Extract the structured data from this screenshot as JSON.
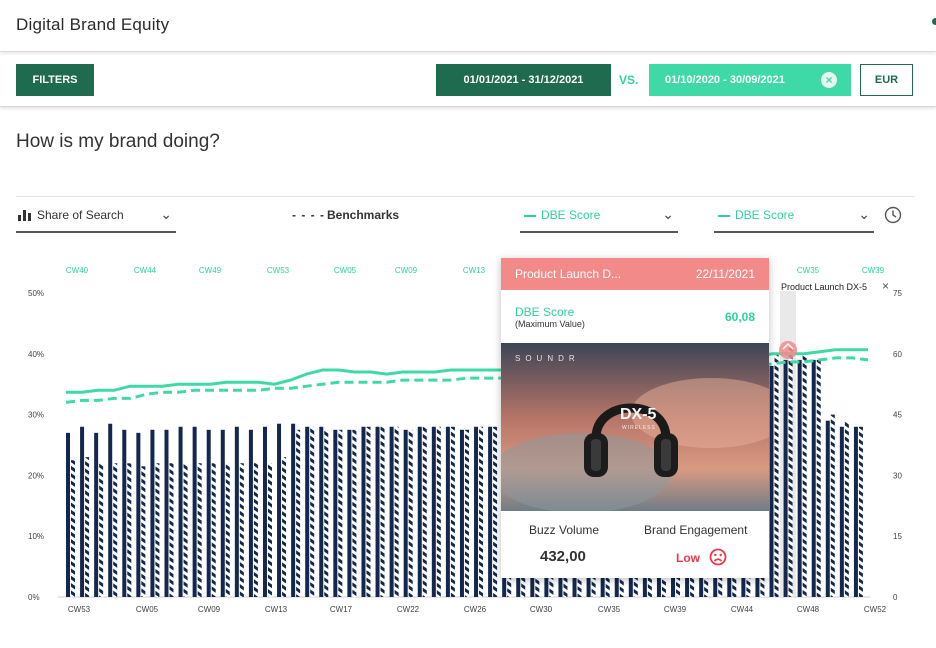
{
  "app": {
    "title": "Digital Brand Equity"
  },
  "filters": {
    "filters_label": "FILTERS",
    "date_range": "01/01/2021 - 31/12/2021",
    "vs_label": "VS.",
    "compare_range": "01/10/2020 - 30/09/2021",
    "currency": "EUR"
  },
  "page": {
    "question": "How is my brand doing?"
  },
  "controls": {
    "share_of_search": "Share of Search",
    "benchmarks": "Benchmarks",
    "dbe_score_1": "DBE Score",
    "dbe_score_2": "DBE Score"
  },
  "colors": {
    "brand_green": "#1f6b50",
    "accent_mint": "#3fd9a7",
    "bar_navy": "#14274e",
    "tooltip_header": "#f28a8a",
    "low_red": "#e83a4a"
  },
  "tooltip": {
    "title": "Product Launch D...",
    "date": "22/11/2021",
    "score_label": "DBE Score",
    "score_sub": "(Maximum Value)",
    "score_value": "60,08",
    "image": {
      "brand": "SOUNDR",
      "model": "DX-5",
      "subtitle": "WIRELESS"
    },
    "buzz_label": "Buzz Volume",
    "buzz_value": "432,00",
    "engagement_label": "Brand Engagement",
    "engagement_value": "Low"
  },
  "event_marker": {
    "label": "Product Launch DX-5"
  },
  "chart_data": {
    "type": "bar",
    "left_axis": {
      "ticks": [
        "0%",
        "10%",
        "20%",
        "30%",
        "40%",
        "50%"
      ],
      "range": [
        0,
        50
      ]
    },
    "right_axis": {
      "ticks": [
        "0",
        "15",
        "30",
        "45",
        "60",
        "75"
      ],
      "range": [
        0,
        75
      ]
    },
    "top_week_labels": [
      "CW40",
      "CW44",
      "CW49",
      "CW53",
      "CW05",
      "CW09",
      "CW13",
      "CW35",
      "CW39"
    ],
    "bottom_week_labels": [
      "CW53",
      "CW05",
      "CW09",
      "CW13",
      "CW17",
      "CW22",
      "CW26",
      "CW30",
      "CW35",
      "CW39",
      "CW44",
      "CW48",
      "CW52"
    ],
    "series": [
      {
        "name": "Share of Search",
        "values": [
          27,
          28,
          27,
          28.5,
          27.5,
          27,
          27.5,
          27.5,
          28,
          28,
          27.5,
          27.5,
          28,
          27.5,
          28,
          28.5,
          28.5,
          28,
          28,
          27.5,
          27.5,
          28,
          28,
          28,
          27.5,
          28,
          28,
          28,
          27.5,
          28,
          28,
          28,
          28,
          28,
          28,
          28,
          28,
          28,
          28,
          28,
          28,
          28,
          28,
          28,
          28,
          28,
          28,
          28,
          28,
          28,
          38,
          39,
          39,
          39,
          29,
          28,
          28
        ]
      },
      {
        "name": "Share of Search (comparison)",
        "values": [
          22.5,
          23,
          22,
          22,
          22,
          21.5,
          22,
          22,
          22,
          22,
          22,
          22,
          22,
          22,
          22,
          23,
          27.5,
          28,
          27.5,
          27.5,
          27.5,
          28,
          28,
          28,
          27.5,
          28,
          28,
          28,
          27.5,
          28,
          28,
          28,
          28,
          28,
          28,
          28,
          28,
          28,
          28,
          28,
          28,
          28,
          28,
          28,
          28,
          28,
          28,
          28,
          28,
          28,
          40,
          41,
          40,
          39,
          30,
          29,
          28
        ]
      },
      {
        "name": "DBE Score",
        "values": [
          50.5,
          50.5,
          51,
          51,
          52,
          52,
          52,
          52.5,
          52.5,
          52.5,
          53,
          53,
          53,
          52.5,
          53.5,
          55,
          56,
          56,
          55.5,
          55.5,
          55,
          55.5,
          55.5,
          55.5,
          56,
          56,
          56,
          56,
          56,
          56,
          56,
          56,
          56,
          56,
          56,
          56,
          56,
          56,
          57,
          57,
          58,
          58,
          59,
          59,
          60,
          60,
          60,
          60.5,
          61,
          61,
          61
        ]
      },
      {
        "name": "Benchmarks",
        "values": [
          48,
          48.5,
          48.5,
          49,
          49,
          50,
          50.5,
          50.5,
          51,
          51,
          51,
          51,
          51,
          51.5,
          51.5,
          52,
          52.5,
          53,
          53,
          53,
          53,
          53.5,
          53.5,
          53.5,
          53.5,
          54,
          54,
          54,
          54,
          54,
          54,
          54,
          54,
          54,
          54,
          54,
          54,
          54,
          55,
          55,
          56,
          56,
          57,
          57,
          57.5,
          58,
          58,
          58.5,
          59,
          59,
          58.5
        ]
      }
    ],
    "event": {
      "label": "Product Launch DX-5"
    }
  }
}
